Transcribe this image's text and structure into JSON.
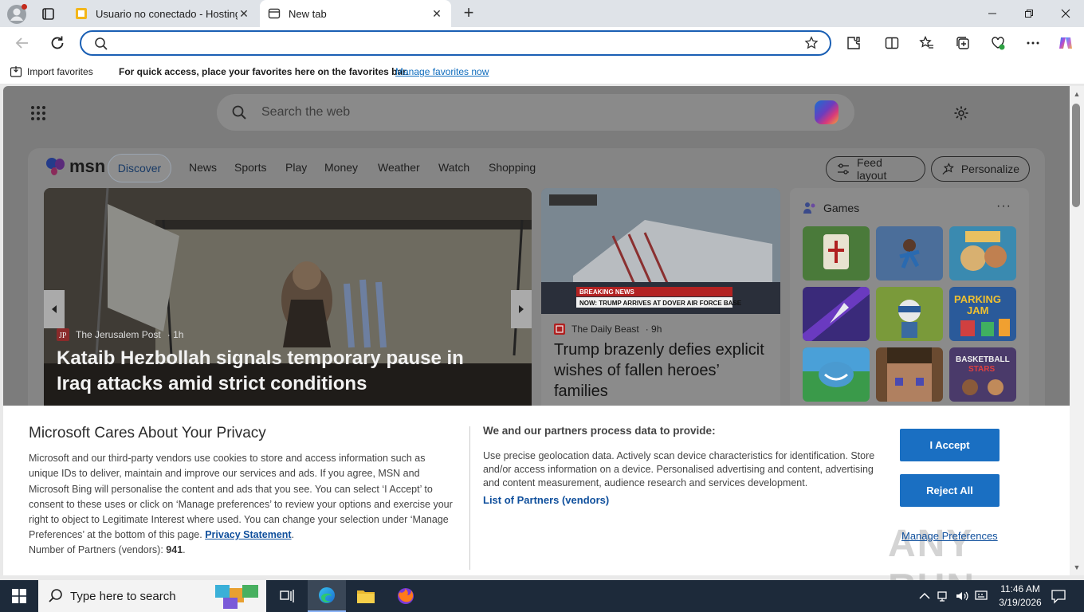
{
  "tabs": [
    {
      "title": "Usuario no conectado - Hosting",
      "active": false
    },
    {
      "title": "New tab",
      "active": true
    }
  ],
  "address_bar": {
    "value": ""
  },
  "favorites_bar": {
    "import_label": "Import favorites",
    "message": "For quick access, place your favorites here on the favorites bar.",
    "manage_link": "Manage favorites now"
  },
  "msn": {
    "search_placeholder": "Search the web",
    "logo_text": "msn",
    "nav": [
      "Discover",
      "News",
      "Sports",
      "Play",
      "Money",
      "Weather",
      "Watch",
      "Shopping"
    ],
    "feed_layout_label": "Feed layout",
    "personalize_label": "Personalize",
    "hero": {
      "source": "The Jerusalem Post",
      "age": "1h",
      "title": "Kataib Hezbollah signals temporary pause in Iraq attacks amid strict conditions"
    },
    "card": {
      "source": "The Daily Beast",
      "age": "9h",
      "title": "Trump brazenly defies explicit wishes of fallen heroes’ families",
      "breaking": "BREAKING NEWS",
      "ticker": "NOW: TRUMP ARRIVES AT DOVER AIR FORCE BASE"
    },
    "games": {
      "title": "Games",
      "more": "···"
    }
  },
  "privacy": {
    "title": "Microsoft Cares About Your Privacy",
    "body": "Microsoft and our third-party vendors use cookies to store and access information such as unique IDs to deliver, maintain and improve our services and ads. If you agree, MSN and Microsoft Bing will personalise the content and ads that you see. You can select ‘I Accept’ to consent to these uses or click on ‘Manage preferences’ to review your options and exercise your right to object to Legitimate Interest where used.  You can change your selection under ‘Manage Preferences’ at the bottom of this page.",
    "statement_link": "Privacy Statement",
    "partners_label": "Number of Partners (vendors):",
    "partners_count": "941",
    "subtitle": "We and our partners process data to provide:",
    "description": "Use precise geolocation data. Actively scan device characteristics for identification. Store and/or access information on a device. Personalised advertising and content, advertising and content measurement, audience research and services development.",
    "partners_link": "List of Partners (vendors)",
    "accept_label": "I Accept",
    "reject_label": "Reject All",
    "manage_label": "Manage Preferences"
  },
  "watermark": "ANY RUN",
  "taskbar": {
    "search_placeholder": "Type here to search",
    "time": "11:46 AM",
    "date": "3/19/2026"
  },
  "colors": {
    "accent": "#1a6fc2",
    "link": "#0f4f9c",
    "taskbar": "#1d2a3a"
  }
}
